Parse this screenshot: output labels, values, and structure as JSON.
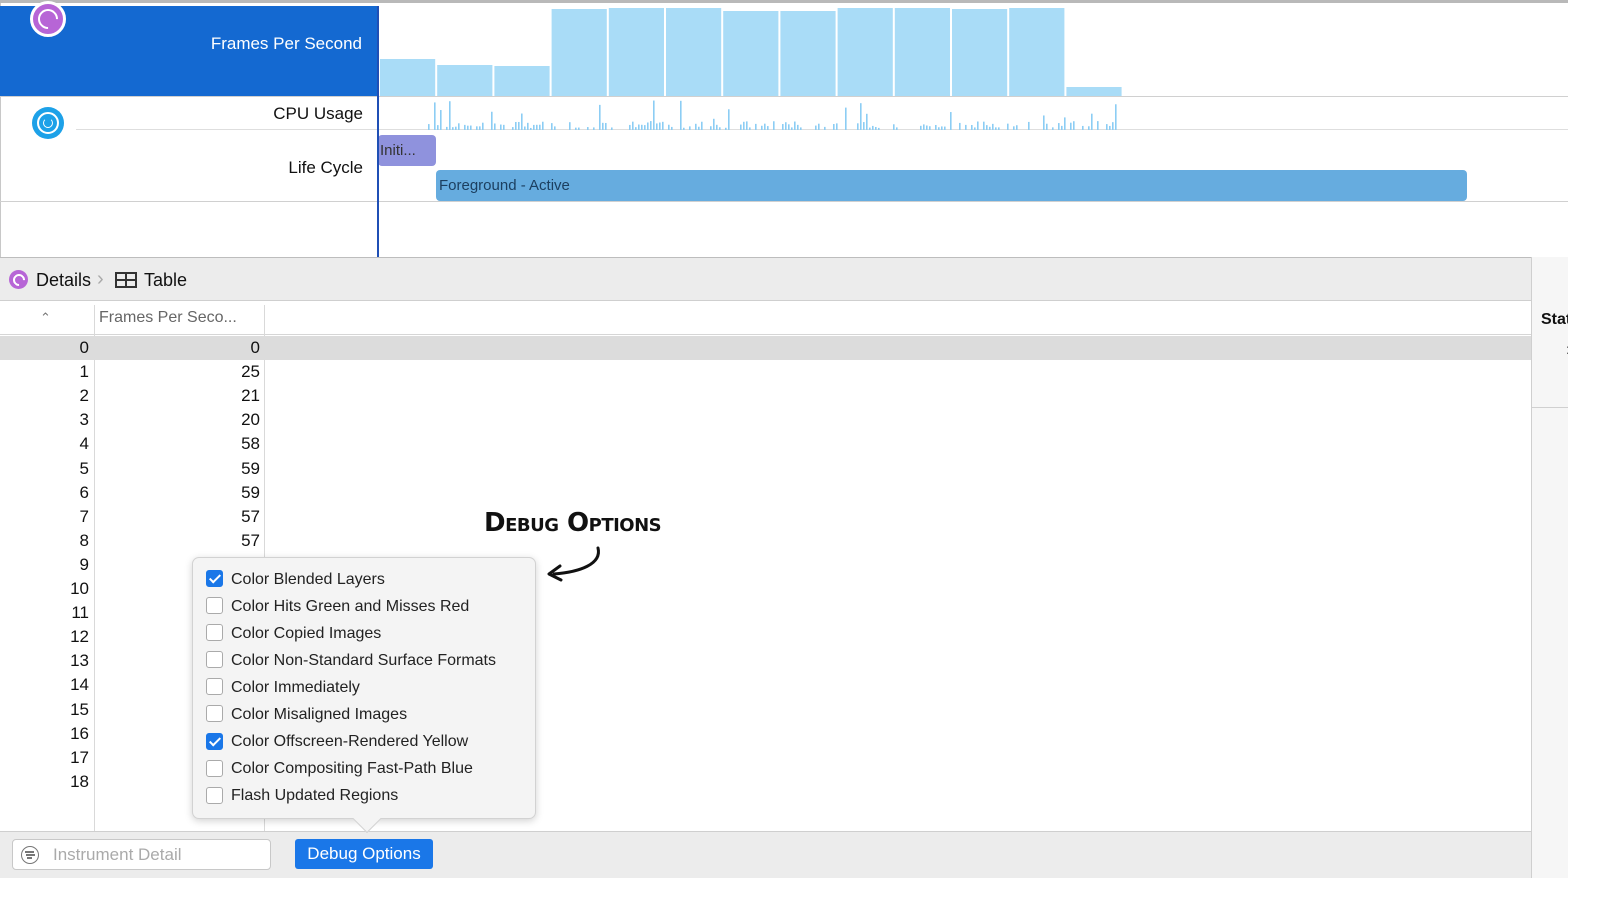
{
  "timeline": {
    "fps_label": "Frames Per Second",
    "cpu_label": "CPU Usage",
    "lifecycle_label": "Life Cycle",
    "fps_bars": [
      25,
      21,
      20,
      58,
      59,
      59,
      57,
      57,
      59,
      59,
      58,
      59,
      6
    ],
    "lifecycle": {
      "initial_label": "Initi...",
      "foreground_label": "Foreground - Active"
    }
  },
  "details": {
    "breadcrumb_details": "Details",
    "breadcrumb_table": "Table"
  },
  "table": {
    "fps_header": "Frames Per Seco...",
    "rows": [
      {
        "index": "0",
        "fps": "0"
      },
      {
        "index": "1",
        "fps": "25"
      },
      {
        "index": "2",
        "fps": "21"
      },
      {
        "index": "3",
        "fps": "20"
      },
      {
        "index": "4",
        "fps": "58"
      },
      {
        "index": "5",
        "fps": "59"
      },
      {
        "index": "6",
        "fps": "59"
      },
      {
        "index": "7",
        "fps": "57"
      },
      {
        "index": "8",
        "fps": "57"
      },
      {
        "index": "9",
        "fps": ""
      },
      {
        "index": "10",
        "fps": ""
      },
      {
        "index": "11",
        "fps": ""
      },
      {
        "index": "12",
        "fps": ""
      },
      {
        "index": "13",
        "fps": ""
      },
      {
        "index": "14",
        "fps": ""
      },
      {
        "index": "15",
        "fps": ""
      },
      {
        "index": "16",
        "fps": ""
      },
      {
        "index": "17",
        "fps": ""
      },
      {
        "index": "18",
        "fps": ""
      }
    ]
  },
  "inspector": {
    "label": "Stat",
    "tick": ":"
  },
  "bottom": {
    "filter_placeholder": "Instrument Detail",
    "debug_button": "Debug Options"
  },
  "popover": {
    "options": [
      {
        "label": "Color Blended Layers",
        "checked": true
      },
      {
        "label": "Color Hits Green and Misses Red",
        "checked": false
      },
      {
        "label": "Color Copied Images",
        "checked": false
      },
      {
        "label": "Color Non-Standard Surface Formats",
        "checked": false
      },
      {
        "label": "Color Immediately",
        "checked": false
      },
      {
        "label": "Color Misaligned Images",
        "checked": false
      },
      {
        "label": "Color Offscreen-Rendered Yellow",
        "checked": true
      },
      {
        "label": "Color Compositing Fast-Path Blue",
        "checked": false
      },
      {
        "label": "Flash Updated Regions",
        "checked": false
      }
    ]
  },
  "annotation": {
    "text": "Debug Options"
  },
  "colors": {
    "selection_blue": "#1469d1",
    "fps_bar": "#a9dcf7",
    "cpu_bar": "#8ccdf4",
    "lifecycle_initial": "#8f92dd",
    "lifecycle_foreground": "#66acdf",
    "accent_button": "#1a77e8",
    "instrument_purple": "#b765d6",
    "instrument_cyan": "#1da1e8"
  }
}
